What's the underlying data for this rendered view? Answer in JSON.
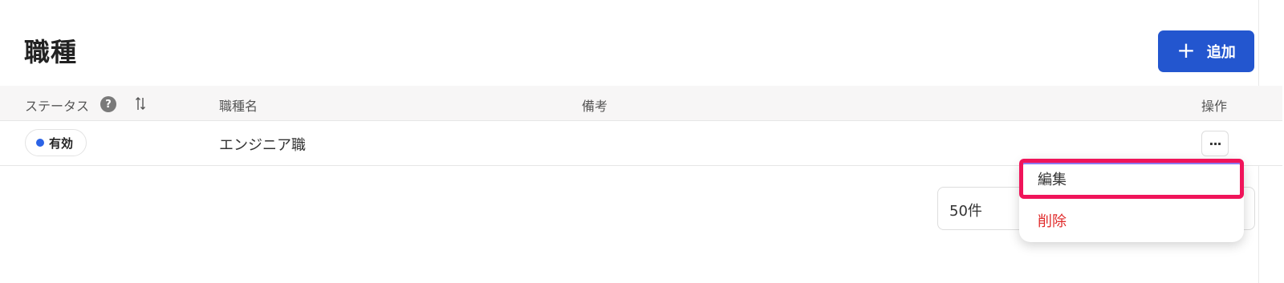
{
  "page": {
    "title": "職種",
    "add_button_label": "追加",
    "add_icon": "plus-icon"
  },
  "table": {
    "columns": {
      "status": "ステータス",
      "name": "職種名",
      "note": "備考",
      "actions": "操作"
    },
    "help_icon_glyph": "?",
    "rows": [
      {
        "status": "有効",
        "status_color": "#2b63e6",
        "name": "エンジニア職",
        "note": ""
      }
    ]
  },
  "pagination": {
    "per_page_value": "50件"
  },
  "menu": {
    "items": [
      {
        "label": "編集",
        "color": "#333333"
      },
      {
        "label": "削除",
        "color": "#e02a2a"
      }
    ]
  },
  "colors": {
    "primary": "#2356cf",
    "highlight": "#f0145a",
    "danger": "#e02a2a"
  }
}
